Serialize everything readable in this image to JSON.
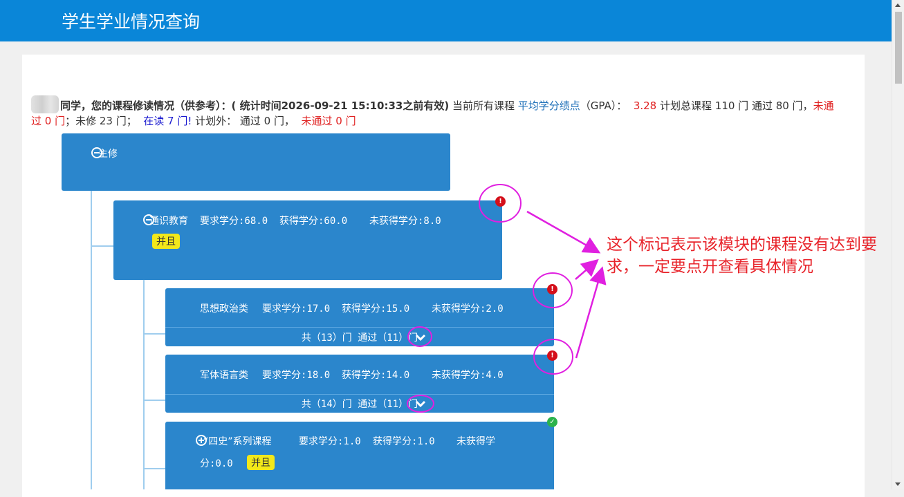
{
  "header": {
    "title": "学生学业情况查询"
  },
  "summary": {
    "intro": "同学，您的课程修读情况（供参考）：( 统计时间2026-09-21 15:10:33之前有效)",
    "current_label": " 当前所有课程 ",
    "gpa_label": "平均学分绩点",
    "gpa_paren": "（GPA）：",
    "gpa_value": "3.28",
    "plan_total": "  计划总课程 110 门 通过 80 门，",
    "plan_failed": "未通过 0 门",
    "plan_unstudied": "；未修 23 门；",
    "plan_inprogress": "在读 7 门!",
    "outside_label": " 计划外： 通过 0 门，",
    "outside_failed": "未通过 0 门"
  },
  "tree": {
    "root": {
      "label": "主修"
    },
    "general": {
      "label": "通识教育",
      "required": "要求学分:68.0",
      "earned": "获得学分:60.0",
      "missing": "未获得学分:8.0",
      "tag": "并且",
      "status_icon": "error-icon"
    },
    "politics": {
      "label": "思想政治类",
      "required": "要求学分:17.0",
      "earned": "获得学分:15.0",
      "missing": "未获得学分:2.0",
      "footer": "共（13）门 通过（11）门",
      "status_icon": "error-icon"
    },
    "military": {
      "label": "军体语言类",
      "required": "要求学分:18.0",
      "earned": "获得学分:14.0",
      "missing": "未获得学分:4.0",
      "footer": "共（14）门 通过（11）门",
      "status_icon": "error-icon"
    },
    "history": {
      "label": "“四史”系列课程",
      "required": "要求学分:1.0",
      "earned": "获得学分:1.0",
      "missing_1": "未获得学",
      "missing_2": "分:0.0",
      "tag": "并且",
      "status_icon": "check-icon"
    }
  },
  "annotation": {
    "line1": "这个标记表示该模块的课程没有达到要",
    "line2": "求，一定要点开查看具体情况",
    "color": "#e8232a"
  },
  "colors": {
    "topbar": "#0a86d8",
    "node": "#2b86cc",
    "tag": "#f2e81a",
    "annotation": "#e8232a",
    "marker_circle": "#e020e0"
  }
}
